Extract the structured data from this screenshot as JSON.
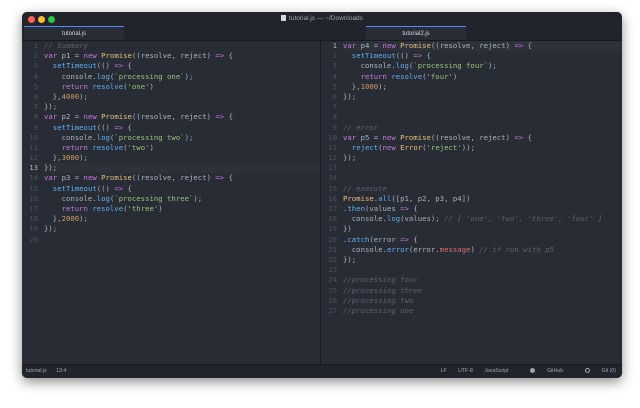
{
  "window": {
    "title": "tutorial.js — ~/Downloads"
  },
  "tabs": [
    {
      "label": "tutorial.js"
    },
    {
      "label": "tutorial2.js"
    }
  ],
  "status": {
    "file": "tutorial.js",
    "position": "13:4",
    "line_ending": "LF",
    "encoding": "UTF-8",
    "grammar": "JavaScript",
    "github": "GitHub",
    "git": "Git (0)"
  },
  "colors": {
    "editor_bg": "#282c34",
    "keyword": "#c678dd",
    "function": "#61afef",
    "string": "#98c379",
    "number": "#d19a66",
    "comment": "#5c6370",
    "property": "#e06c75",
    "class": "#e5c07b"
  },
  "left_pane": {
    "line_numbers": [
      "1",
      "2",
      "3",
      "4",
      "5",
      "6",
      "7",
      "8",
      "9",
      "10",
      "11",
      "12",
      "13",
      "14",
      "15",
      "16",
      "17",
      "18",
      "19",
      "20"
    ],
    "cursor_line": 13,
    "lines": [
      [
        [
          "c",
          "// Summary"
        ]
      ],
      [
        [
          "k",
          "var"
        ],
        [
          "t",
          " p1 = "
        ],
        [
          "k",
          "new"
        ],
        [
          "t",
          " "
        ],
        [
          "y",
          "Promise"
        ],
        [
          "t",
          "((resolve, reject) "
        ],
        [
          "k",
          "=>"
        ],
        [
          "t",
          " {"
        ]
      ],
      [
        [
          "t",
          "  "
        ],
        [
          "f",
          "setTimeout"
        ],
        [
          "t",
          "(() "
        ],
        [
          "k",
          "=>"
        ],
        [
          "t",
          " {"
        ]
      ],
      [
        [
          "t",
          "    console."
        ],
        [
          "f",
          "log"
        ],
        [
          "t",
          "("
        ],
        [
          "s",
          "`processing one`"
        ],
        [
          "t",
          ");"
        ]
      ],
      [
        [
          "t",
          "    "
        ],
        [
          "k",
          "return"
        ],
        [
          "t",
          " "
        ],
        [
          "f",
          "resolve"
        ],
        [
          "t",
          "("
        ],
        [
          "s",
          "'one'"
        ],
        [
          "t",
          ")"
        ]
      ],
      [
        [
          "t",
          "  },"
        ],
        [
          "n",
          "4000"
        ],
        [
          "t",
          ");"
        ]
      ],
      [
        [
          "t",
          "});"
        ]
      ],
      [
        [
          "k",
          "var"
        ],
        [
          "t",
          " p2 = "
        ],
        [
          "k",
          "new"
        ],
        [
          "t",
          " "
        ],
        [
          "y",
          "Promise"
        ],
        [
          "t",
          "((resolve, reject) "
        ],
        [
          "k",
          "=>"
        ],
        [
          "t",
          " {"
        ]
      ],
      [
        [
          "t",
          "  "
        ],
        [
          "f",
          "setTimeout"
        ],
        [
          "t",
          "(() "
        ],
        [
          "k",
          "=>"
        ],
        [
          "t",
          " {"
        ]
      ],
      [
        [
          "t",
          "    console."
        ],
        [
          "f",
          "log"
        ],
        [
          "t",
          "("
        ],
        [
          "s",
          "`processing two`"
        ],
        [
          "t",
          ");"
        ]
      ],
      [
        [
          "t",
          "    "
        ],
        [
          "k",
          "return"
        ],
        [
          "t",
          " "
        ],
        [
          "f",
          "resolve"
        ],
        [
          "t",
          "("
        ],
        [
          "s",
          "'two'"
        ],
        [
          "t",
          ")"
        ]
      ],
      [
        [
          "t",
          "  },"
        ],
        [
          "n",
          "3000"
        ],
        [
          "t",
          ");"
        ]
      ],
      [
        [
          "t",
          "});"
        ]
      ],
      [
        [
          "k",
          "var"
        ],
        [
          "t",
          " p3 = "
        ],
        [
          "k",
          "new"
        ],
        [
          "t",
          " "
        ],
        [
          "y",
          "Promise"
        ],
        [
          "t",
          "((resolve, reject) "
        ],
        [
          "k",
          "=>"
        ],
        [
          "t",
          " {"
        ]
      ],
      [
        [
          "t",
          "  "
        ],
        [
          "f",
          "setTimeout"
        ],
        [
          "t",
          "(() "
        ],
        [
          "k",
          "=>"
        ],
        [
          "t",
          " {"
        ]
      ],
      [
        [
          "t",
          "    console."
        ],
        [
          "f",
          "log"
        ],
        [
          "t",
          "("
        ],
        [
          "s",
          "`processing three`"
        ],
        [
          "t",
          ");"
        ]
      ],
      [
        [
          "t",
          "    "
        ],
        [
          "k",
          "return"
        ],
        [
          "t",
          " "
        ],
        [
          "f",
          "resolve"
        ],
        [
          "t",
          "("
        ],
        [
          "s",
          "'three'"
        ],
        [
          "t",
          ")"
        ]
      ],
      [
        [
          "t",
          "  },"
        ],
        [
          "n",
          "2000"
        ],
        [
          "t",
          ");"
        ]
      ],
      [
        [
          "t",
          "});"
        ]
      ],
      []
    ]
  },
  "right_pane": {
    "line_numbers": [
      "1",
      "2",
      "3",
      "4",
      "5",
      "6",
      "7",
      "8",
      "9",
      "10",
      "11",
      "12",
      "13",
      "14",
      "15",
      "16",
      "17",
      "18",
      "19",
      "20",
      "21",
      "22",
      "23",
      "24",
      "25",
      "26",
      "27"
    ],
    "cursor_line": 1,
    "lines": [
      [
        [
          "k",
          "var"
        ],
        [
          "t",
          " p4 = "
        ],
        [
          "k",
          "new"
        ],
        [
          "t",
          " "
        ],
        [
          "y",
          "Promise"
        ],
        [
          "t",
          "((resolve, reject) "
        ],
        [
          "k",
          "=>"
        ],
        [
          "t",
          " {"
        ]
      ],
      [
        [
          "t",
          "  "
        ],
        [
          "f",
          "setTimeout"
        ],
        [
          "t",
          "(() "
        ],
        [
          "k",
          "=>"
        ],
        [
          "t",
          " {"
        ]
      ],
      [
        [
          "t",
          "    console."
        ],
        [
          "f",
          "log"
        ],
        [
          "t",
          "("
        ],
        [
          "s",
          "`processing four`"
        ],
        [
          "t",
          ");"
        ]
      ],
      [
        [
          "t",
          "    "
        ],
        [
          "k",
          "return"
        ],
        [
          "t",
          " "
        ],
        [
          "f",
          "resolve"
        ],
        [
          "t",
          "("
        ],
        [
          "s",
          "'four'"
        ],
        [
          "t",
          ")"
        ]
      ],
      [
        [
          "t",
          "  },"
        ],
        [
          "n",
          "1000"
        ],
        [
          "t",
          ");"
        ]
      ],
      [
        [
          "t",
          "});"
        ]
      ],
      [],
      [],
      [
        [
          "c",
          "// error"
        ]
      ],
      [
        [
          "k",
          "var"
        ],
        [
          "t",
          " p5 = "
        ],
        [
          "k",
          "new"
        ],
        [
          "t",
          " "
        ],
        [
          "y",
          "Promise"
        ],
        [
          "t",
          "((resolve, reject) "
        ],
        [
          "k",
          "=>"
        ],
        [
          "t",
          " {"
        ]
      ],
      [
        [
          "t",
          "  "
        ],
        [
          "f",
          "reject"
        ],
        [
          "t",
          "("
        ],
        [
          "k",
          "new"
        ],
        [
          "t",
          " "
        ],
        [
          "y",
          "Error"
        ],
        [
          "t",
          "("
        ],
        [
          "s",
          "'reject'"
        ],
        [
          "t",
          "));"
        ]
      ],
      [
        [
          "t",
          "});"
        ]
      ],
      [],
      [],
      [
        [
          "c",
          "// execute"
        ]
      ],
      [
        [
          "y",
          "Promise"
        ],
        [
          "t",
          "."
        ],
        [
          "f",
          "all"
        ],
        [
          "t",
          "([p1, p2, p3, p4])"
        ]
      ],
      [
        [
          "t",
          "."
        ],
        [
          "f",
          "then"
        ],
        [
          "t",
          "(values "
        ],
        [
          "k",
          "=>"
        ],
        [
          "t",
          " {"
        ]
      ],
      [
        [
          "t",
          "  console."
        ],
        [
          "f",
          "log"
        ],
        [
          "t",
          "(values); "
        ],
        [
          "c",
          "// [ 'one', 'two', 'three', 'four' ]"
        ]
      ],
      [
        [
          "t",
          "})"
        ]
      ],
      [
        [
          "t",
          "."
        ],
        [
          "f",
          "catch"
        ],
        [
          "t",
          "(error "
        ],
        [
          "k",
          "=>"
        ],
        [
          "t",
          " {"
        ]
      ],
      [
        [
          "t",
          "  console."
        ],
        [
          "f",
          "error"
        ],
        [
          "t",
          "(error."
        ],
        [
          "p",
          "message"
        ],
        [
          "t",
          ") "
        ],
        [
          "c",
          "// if run with p5"
        ]
      ],
      [
        [
          "t",
          "});"
        ]
      ],
      [],
      [
        [
          "c",
          "//processing four"
        ]
      ],
      [
        [
          "c",
          "//processing three"
        ]
      ],
      [
        [
          "c",
          "//processing two"
        ]
      ],
      [
        [
          "c",
          "//processing one"
        ]
      ]
    ]
  }
}
